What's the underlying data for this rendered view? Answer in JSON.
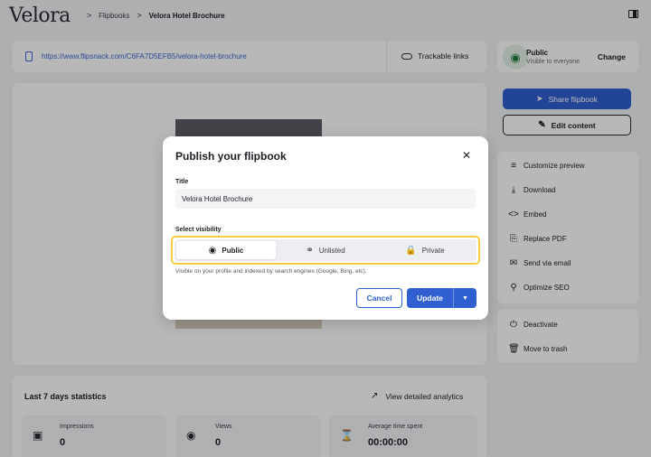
{
  "header": {
    "logo": "Velora",
    "breadcrumbs": [
      {
        "sep": ">",
        "label": "Flipbooks"
      },
      {
        "sep": ">",
        "label": "Velora Hotel Brochure"
      }
    ]
  },
  "urlbar": {
    "url": "https://www.flipsnack.com/C6FA7D5EFB5/velora-hotel-brochure",
    "trackable_label": "Trackable links"
  },
  "visibility_card": {
    "title": "Public",
    "subtitle": "Visible to everyone",
    "change_label": "Change"
  },
  "actions": {
    "share_label": "Share flipbook",
    "edit_label": "Edit content"
  },
  "menu": [
    {
      "icon": "sliders-icon",
      "label": "Customize preview"
    },
    {
      "icon": "download-icon",
      "label": "Download"
    },
    {
      "icon": "code-icon",
      "label": "Embed"
    },
    {
      "icon": "replace-icon",
      "label": "Replace PDF"
    },
    {
      "icon": "mail-icon",
      "label": "Send via email"
    },
    {
      "icon": "seo-icon",
      "label": "Optimize SEO"
    }
  ],
  "danger_menu": [
    {
      "icon": "power-icon",
      "label": "Deactivate"
    },
    {
      "icon": "trash-icon",
      "label": "Move to trash"
    }
  ],
  "stats": {
    "title": "Last 7 days statistics",
    "analytics_label": "View detailed analytics",
    "items": [
      {
        "icon": "target-icon",
        "label": "Impressions",
        "value": "0"
      },
      {
        "icon": "eye-icon",
        "label": "Views",
        "value": "0"
      },
      {
        "icon": "hourglass-icon",
        "label": "Average time spent",
        "value": "00:00:00"
      }
    ]
  },
  "modal": {
    "title": "Publish your flipbook",
    "title_field_label": "Title",
    "title_value": "Velora Hotel Brochure",
    "visibility_label": "Select visibility",
    "options": [
      {
        "icon": "globe-icon",
        "label": "Public",
        "selected": true
      },
      {
        "icon": "link-icon",
        "label": "Unlisted",
        "selected": false
      },
      {
        "icon": "lock-icon",
        "label": "Private",
        "selected": false
      }
    ],
    "hint": "Visible on your profile and indexed by search engines (Google, Bing, etc).",
    "cancel_label": "Cancel",
    "update_label": "Update"
  },
  "colors": {
    "accent": "#2f5fd0",
    "highlight": "#f2cf3a",
    "public_badge": "#e3f1e6"
  }
}
